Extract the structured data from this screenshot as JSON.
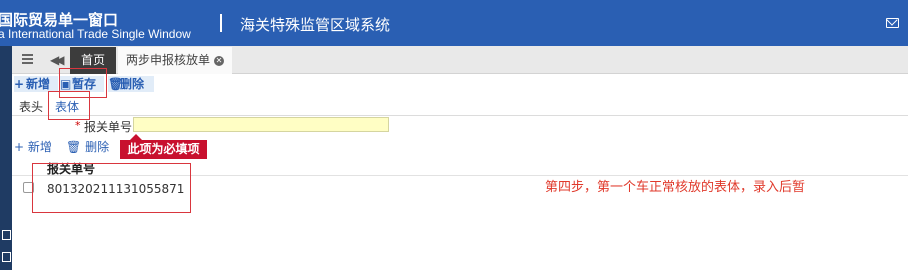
{
  "header": {
    "brand_cn": "国际贸易单一窗口",
    "brand_en": "a International Trade Single Window",
    "separator": "|",
    "system_title": "海关特殊监管区域系统",
    "mail_icon": "mail-icon"
  },
  "tabs": {
    "menu_icon": "menu-icon",
    "back_icon": "double-chevron-left-icon",
    "home_label": "首页",
    "active_label": "两步申报核放单",
    "close_glyph": "✕"
  },
  "toolbar": {
    "add_label": "新增",
    "save_label": "暂存",
    "delete_label": "删除"
  },
  "subtabs": {
    "head_label": "表头",
    "body_label": "表体"
  },
  "form": {
    "required_mark": "*",
    "entry_no_label": "报关单号",
    "entry_no_value": ""
  },
  "tooltip": {
    "text": "此项为必填项"
  },
  "grid": {
    "add_label": "新增",
    "delete_label": "删除",
    "column_header": "报关单号",
    "rows": [
      {
        "entry_no": "801320211131055871"
      }
    ]
  },
  "annotation": {
    "text": "第四步，第一个车正常核放的表体，录入后暂"
  },
  "colors": {
    "header_bg": "#2a5fb3",
    "highlight_red": "#d9363e",
    "required_field_bg": "#fffec4",
    "tooltip_bg": "#c8102e"
  }
}
